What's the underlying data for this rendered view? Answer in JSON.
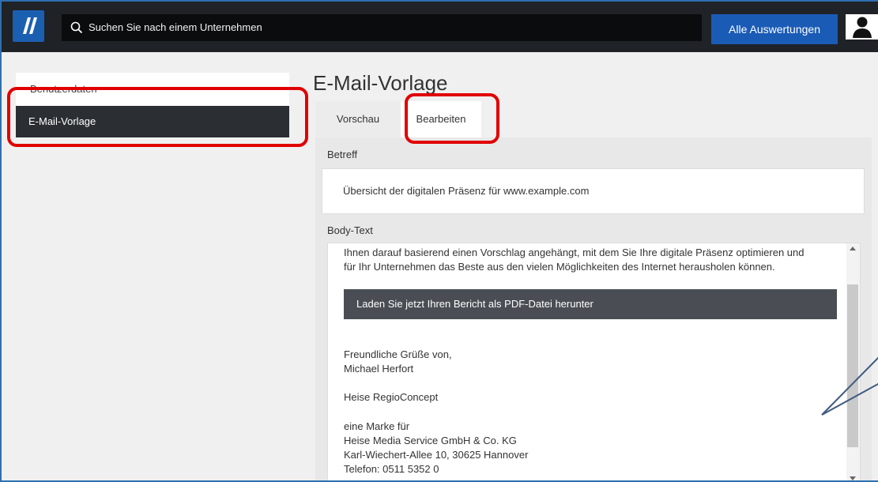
{
  "header": {
    "search_placeholder": "Suchen Sie nach einem Unternehmen",
    "all_reports_label": "Alle Auswertungen"
  },
  "sidebar": {
    "items": [
      {
        "label": "Benutzerdaten"
      },
      {
        "label": "E-Mail-Vorlage"
      }
    ]
  },
  "main": {
    "title": "E-Mail-Vorlage",
    "tabs": [
      {
        "label": "Vorschau"
      },
      {
        "label": "Bearbeiten"
      }
    ],
    "subject_label": "Betreff",
    "subject_value": "Übersicht der digitalen Präsenz für www.example.com",
    "body_label": "Body-Text",
    "body_lines": [
      "Ihnen darauf basierend einen Vorschlag angehängt, mit dem Sie Ihre digitale Präsenz optimieren und",
      "für Ihr Unternehmen das Beste aus den vielen Möglichkeiten des Internet herausholen können."
    ],
    "pdf_button_label": "Laden Sie jetzt Ihren Bericht als PDF-Datei herunter",
    "signature": [
      "Freundliche Grüße von,",
      "Michael Herfort",
      "Heise RegioConcept",
      "eine Marke für",
      "Heise Media Service GmbH & Co. KG",
      "Karl-Wiechert-Allee 10, 30625 Hannover",
      "Telefon: 0511 5352 0"
    ]
  },
  "colors": {
    "highlight": "#e10000",
    "primary": "#1a5bb6",
    "topbar": "#1f2227",
    "callout": "#3d5a80"
  },
  "icons": [
    "logo-icon",
    "search-icon",
    "user-icon",
    "scroll-up-icon",
    "scroll-down-icon"
  ]
}
